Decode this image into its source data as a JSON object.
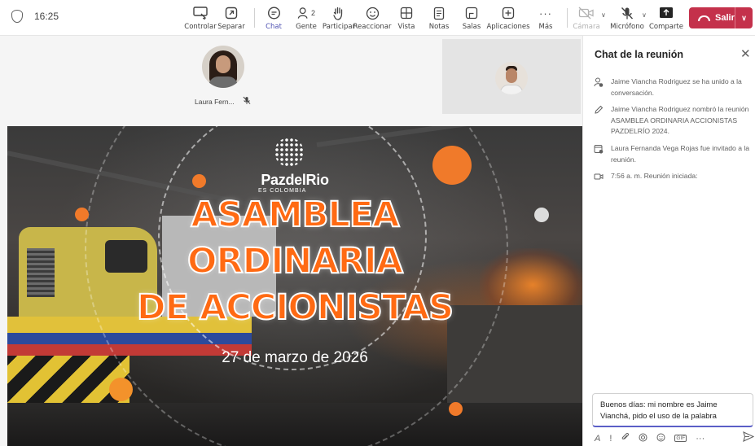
{
  "status": {
    "time": "16:25"
  },
  "toolbar": {
    "controlar": "Controlar",
    "separar": "Separar",
    "chat": "Chat",
    "gente": "Gente",
    "people_count": "2",
    "participar": "Participar",
    "reaccionar": "Reaccionar",
    "vista": "Vista",
    "notas": "Notas",
    "salas": "Salas",
    "aplicaciones": "Aplicaciones",
    "mas": "Más",
    "camara": "Cámara",
    "microfono": "Micrófono",
    "compartir": "Comparte",
    "salir": "Salir"
  },
  "participants": {
    "laura_name": "Laura Fern...",
    "jaime": {
      "avatar": "profile-photo"
    }
  },
  "slide": {
    "brand": "PazdelRio",
    "brand_sub": "ES COLOMBIA",
    "title_line1": "ASAMBLEA",
    "title_line2": "ORDINARIA",
    "title_line3": "DE ACCIONISTAS",
    "date": "27 de marzo de 2026",
    "accent_color": "#ff6a13"
  },
  "chat": {
    "title": "Chat de la reunión",
    "events": [
      {
        "icon": "person-add-icon",
        "text": "Jaime Viancha Rodriguez se ha unido a la conversación."
      },
      {
        "icon": "pencil-icon",
        "text": "Jaime Viancha Rodriguez nombró la reunión ASAMBLEA ORDINARIA ACCIONISTAS PAZDELRÍO 2024."
      },
      {
        "icon": "calendar-person-icon",
        "text": "Laura Fernanda Vega Rojas fue invitado a la reunión."
      },
      {
        "icon": "video-icon",
        "text": "7:56 a. m.   Reunión iniciada:"
      }
    ],
    "compose_value": "Buenos días: mi nombre es Jaime Vianchá, pido el uso de la palabra"
  },
  "colors": {
    "leave": "#c4314b",
    "active_tab": "#5b5fc7"
  }
}
